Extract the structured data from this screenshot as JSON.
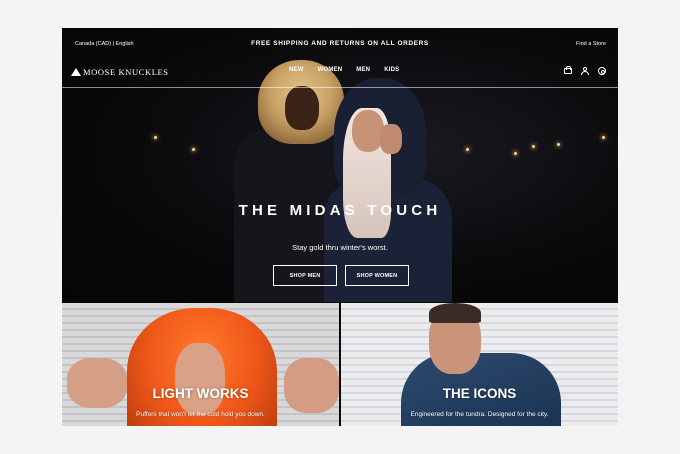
{
  "topbar": {
    "locale": "Canada (CAD) | English",
    "promo": "FREE SHIPPING AND RETURNS ON ALL ORDERS",
    "store_link": "Find a Store"
  },
  "header": {
    "logo": "MOOSE KNUCKLES",
    "nav": [
      "NEW",
      "WOMEN",
      "MEN",
      "KIDS"
    ],
    "icons": [
      "bag-icon",
      "user-icon",
      "search-icon"
    ]
  },
  "hero": {
    "title": "THE MIDAS TOUCH",
    "subtitle": "Stay gold thru winter's worst.",
    "buttons": [
      "SHOP MEN",
      "SHOP WOMEN"
    ]
  },
  "tiles": [
    {
      "title": "LIGHT WORKS",
      "subtitle": "Puffers that won't let the cold hold you down."
    },
    {
      "title": "THE ICONS",
      "subtitle": "Engineered for the tundra. Designed for the city."
    }
  ],
  "colors": {
    "hero_bg": "#0b0a0c",
    "text": "#ffffff",
    "orange": "#f0581a",
    "blue": "#2c4a6e"
  }
}
